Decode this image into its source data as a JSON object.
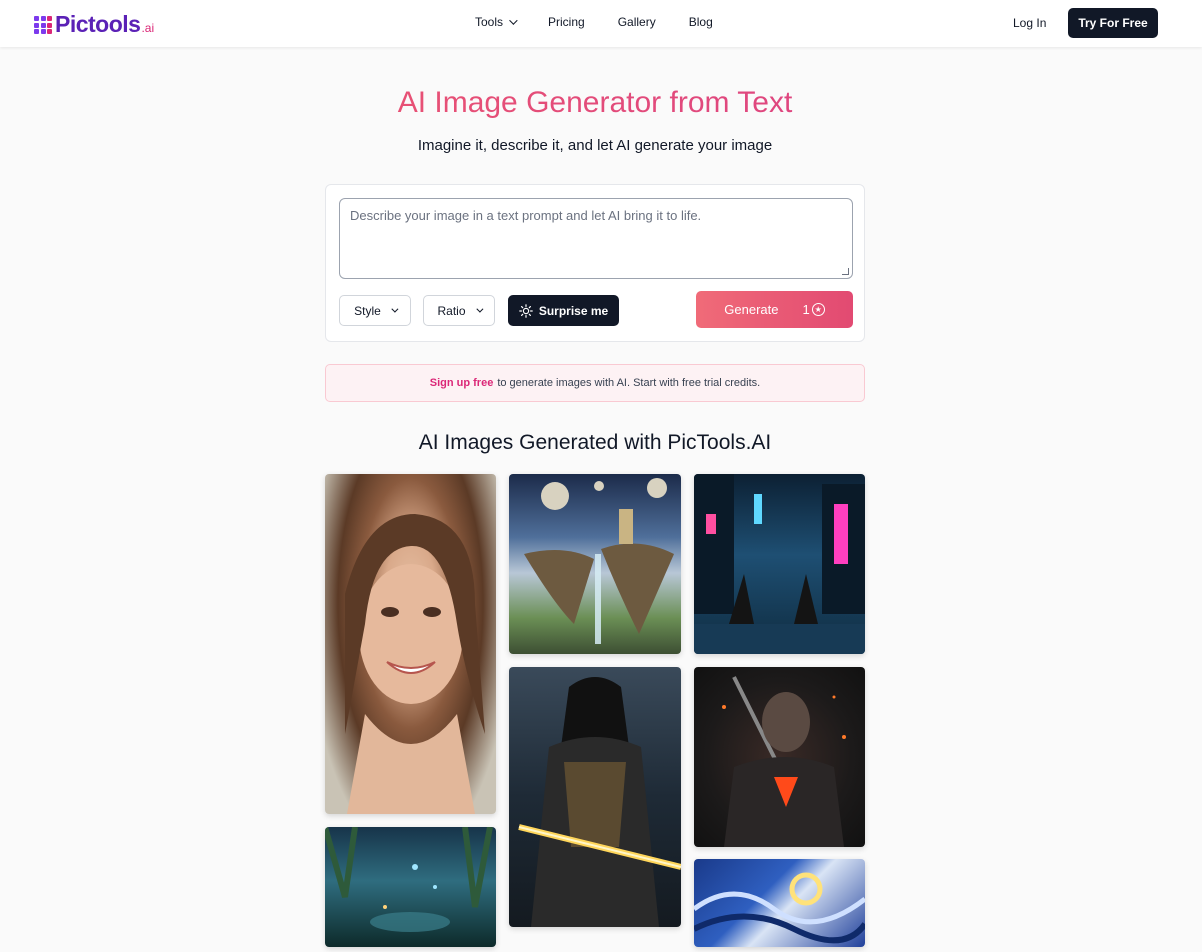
{
  "header": {
    "logo_text": "Pictools",
    "logo_suffix": ".ai",
    "nav": [
      {
        "label": "Tools",
        "has_dropdown": true
      },
      {
        "label": "Pricing"
      },
      {
        "label": "Gallery"
      },
      {
        "label": "Blog"
      }
    ],
    "login_label": "Log In",
    "try_label": "Try For Free"
  },
  "hero": {
    "title": "AI Image Generator from Text",
    "subtitle": "Imagine it, describe it, and let AI generate your image"
  },
  "prompt_card": {
    "placeholder": "Describe your image in a text prompt and let AI bring it to life.",
    "style_label": "Style",
    "ratio_label": "Ratio",
    "surprise_label": "Surprise me",
    "generate_label": "Generate",
    "credit_cost": "1"
  },
  "notice": {
    "link_text": "Sign up free",
    "text": "to generate images with AI. Start with free trial credits."
  },
  "gallery": {
    "title": "AI Images Generated with PicTools.AI",
    "images": [
      "smiling-woman-portrait",
      "floating-islands-fantasy",
      "cyberpunk-city-street",
      "hooded-dark-knight",
      "armored-warrior-fire",
      "glowing-jungle",
      "starry-night-swirl"
    ]
  },
  "colors": {
    "brand_purple": "#5b21b6",
    "brand_pink": "#db2777",
    "dark": "#111827",
    "generate_gradient": [
      "#f06b78",
      "#e24a72"
    ]
  }
}
